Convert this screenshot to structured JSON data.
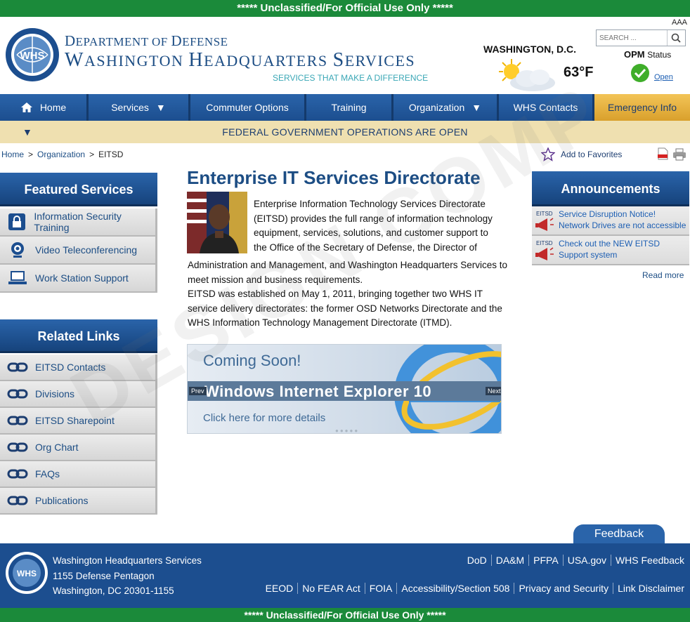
{
  "classification": {
    "top": "***** Unclassified/For Official Use Only *****",
    "bottom": "***** Unclassified/For Official Use Only *****"
  },
  "header": {
    "dept_cap": "D",
    "dept_rest": "EPARTMENT OF ",
    "dept_cap2": "D",
    "dept_rest2": "EFENSE",
    "whs_cap1": "W",
    "whs_rest1": "ASHINGTON ",
    "whs_cap2": "H",
    "whs_rest2": "EADQUARTERS ",
    "whs_cap3": "S",
    "whs_rest3": "ERVICES",
    "tagline": "SERVICES THAT MAKE A DIFFERENCE",
    "seal_text": "WHS",
    "text_size": "AAA",
    "search_placeholder": "SEARCH ...",
    "weather_city": "WASHINGTON, D.C.",
    "temperature": "63°F",
    "opm_label": "OPM",
    "opm_status_word": "Status",
    "opm_value": "Open"
  },
  "nav": {
    "items": [
      {
        "label": "Home",
        "width": 126
      },
      {
        "label": "Services",
        "width": 145,
        "dropdown": true
      },
      {
        "label": "Commuter Options",
        "width": 165
      },
      {
        "label": "Training",
        "width": 124
      },
      {
        "label": "Organization",
        "width": 150,
        "dropdown": true
      },
      {
        "label": "WHS Contacts",
        "width": 136
      },
      {
        "label": "Emergency Info",
        "width": 136,
        "emergency": true
      }
    ]
  },
  "status_bar": "FEDERAL GOVERNMENT OPERATIONS ARE OPEN",
  "breadcrumb": {
    "home": "Home",
    "org": "Organization",
    "current": "EITSD",
    "sep": ">"
  },
  "favorites": "Add to Favorites",
  "featured": {
    "title": "Featured Services",
    "items": [
      "Information Security Training",
      "Video Teleconferencing",
      "Work Station Support"
    ]
  },
  "related": {
    "title": "Related Links",
    "items": [
      "EITSD Contacts",
      "Divisions",
      "EITSD Sharepoint",
      "Org Chart",
      "FAQs",
      "Publications"
    ]
  },
  "main": {
    "title": "Enterprise IT Services Directorate",
    "intro_wrap": "Enterprise Information Technology Services Directorate (EITSD) provides the full range of information technology equipment, services, solutions, and customer support to the Office of the Secretary of Defense, the Director of",
    "intro_cont": "Administration and Management, and Washington Headquarters Services to meet mission and business requirements.",
    "history": "EITSD was established on May 1, 2011, bringing together two WHS IT service delivery directorates: the former OSD Networks Directorate and the WHS Information Technology Management Directorate (ITMD)."
  },
  "banner": {
    "coming": "Coming Soon!",
    "product": "Windows Internet Explorer 10",
    "click": "Click here for more details",
    "prev": "Prev",
    "next": "Next"
  },
  "announcements": {
    "title": "Announcements",
    "badge": "EITSD",
    "items": [
      {
        "line1": "Service Disruption Notice!",
        "line2": "Network Drives are not accessible"
      },
      {
        "line1": "Check out the NEW EITSD",
        "line2": "Support system"
      }
    ],
    "read_more": "Read more"
  },
  "feedback": "Feedback",
  "footer": {
    "addr1": "Washington Headquarters Services",
    "addr2": "1155 Defense Pentagon",
    "addr3": "Washington, DC 20301-1155",
    "row1": [
      "DoD",
      "DA&M",
      "PFPA",
      "USA.gov",
      "WHS Feedback"
    ],
    "row2": [
      "EEOD",
      "No FEAR Act",
      "FOIA",
      "Accessibility/Section 508",
      "Privacy and Security",
      "Link Disclaimer"
    ]
  },
  "watermark": "DESIGN COMP",
  "colors": {
    "navy": "#1c4e8f",
    "green": "#1b8a3a",
    "gold": "#d9a02c",
    "status_bg": "#efe0b0"
  }
}
